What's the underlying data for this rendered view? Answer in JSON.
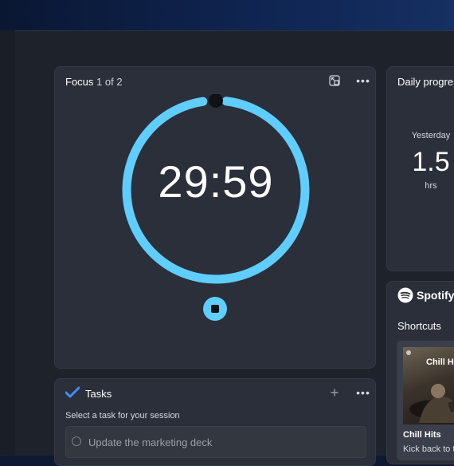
{
  "focus": {
    "title": "Focus",
    "counter": "1 of 2",
    "timer": "29:59",
    "progress": 0.995,
    "accent": "#60cdff"
  },
  "daily": {
    "title": "Daily progress",
    "yesterday_label": "Yesterday",
    "yesterday_value": "1.5",
    "yesterday_unit": "hrs"
  },
  "spotify": {
    "brand": "Spotify",
    "shortcuts_label": "Shortcuts",
    "playlist_art_title": "Chill Hits",
    "playlist_name": "Chill Hits",
    "playlist_subtitle": "Kick back to t"
  },
  "tasks": {
    "title": "Tasks",
    "prompt": "Select a task for your session",
    "items": [
      {
        "label": "Update the marketing deck"
      }
    ]
  }
}
